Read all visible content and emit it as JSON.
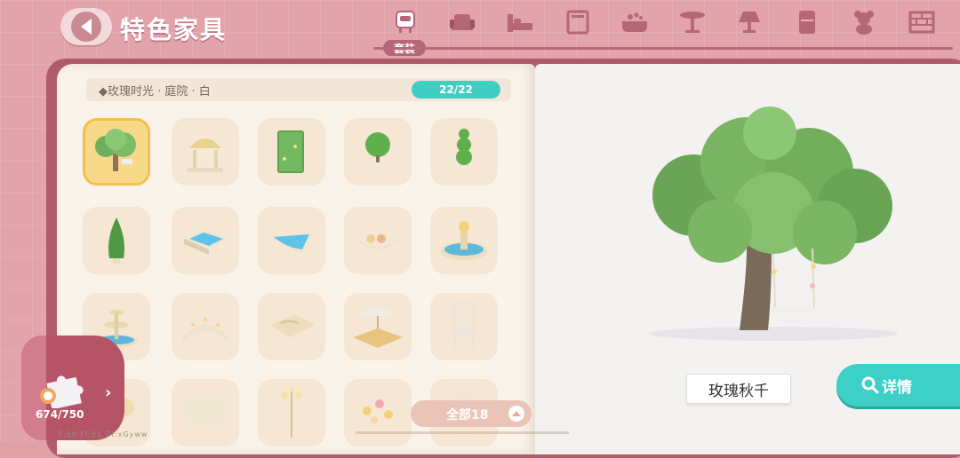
{
  "header": {
    "title": "特色家具",
    "active_category_label": "套装"
  },
  "categories": [
    "suit-icon",
    "sofa-icon",
    "bed-icon",
    "cabinet-icon",
    "bathtub-icon",
    "table-icon",
    "lamp-icon",
    "fridge-icon",
    "teddy-bear-icon",
    "wall-icon"
  ],
  "set_bar": {
    "name": "◆玫瑰时光 · 庭院 · 白",
    "count": "22/22"
  },
  "grid": {
    "items": [
      "tree-swing",
      "gazebo",
      "hedge-wall",
      "round-topiary",
      "tiered-topiary",
      "cone-topiary",
      "square-pool",
      "corner-pool",
      "boat-planter",
      "fountain",
      "tiered-fountain",
      "garden-bridge",
      "stone-path",
      "picnic-umbrella",
      "garden-chair",
      "flower-cart",
      "round-table",
      "street-lamp",
      "flower-petals",
      "arch"
    ]
  },
  "capacity": {
    "text": "674/750"
  },
  "filter": {
    "label": "全部18"
  },
  "coords": "F:50 Fl:51 Di:xGyww",
  "preview": {
    "name": "玫瑰秋千",
    "detail_label": "详情"
  },
  "colors": {
    "accent": "#3fcdc4",
    "brand": "#b45466",
    "tile": "#f6e6d4"
  }
}
